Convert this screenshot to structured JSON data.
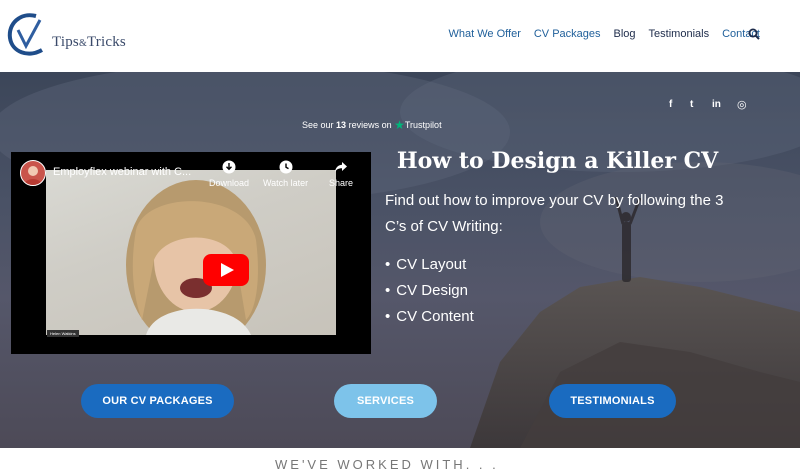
{
  "header": {
    "logo_text": "Tips",
    "logo_amp": "&",
    "logo_text2": "Tricks",
    "nav": [
      "What We Offer",
      "CV Packages",
      "Blog",
      "Testimonials",
      "Contact"
    ]
  },
  "social": {
    "facebook": "f",
    "twitter": "t",
    "linkedin": "in",
    "instagram": "◎"
  },
  "trustpilot": {
    "prefix": "See our",
    "count": "13",
    "suffix": "reviews on",
    "brand": "Trustpilot"
  },
  "video": {
    "title": "Employflex webinar with C...",
    "download_label": "Download",
    "watch_later_label": "Watch later",
    "share_label": "Share",
    "name_tag": "Helen Watkins"
  },
  "hero": {
    "title": "How to Design a Killer CV",
    "intro": "Find out how to improve your CV by following the 3 C’s of CV Writing:",
    "bullets": [
      "CV Layout",
      "CV Design",
      "CV Content"
    ]
  },
  "buttons": {
    "packages": "OUR CV PACKAGES",
    "services": "SERVICES",
    "testimonials": "TESTIMONIALS"
  },
  "worked_with": "WE'VE WORKED WITH. . .",
  "colors": {
    "accent": "#1a6bc0",
    "accent_light": "#7dc3ea",
    "trustpilot_green": "#00b67a",
    "youtube_red": "#ff0000"
  }
}
